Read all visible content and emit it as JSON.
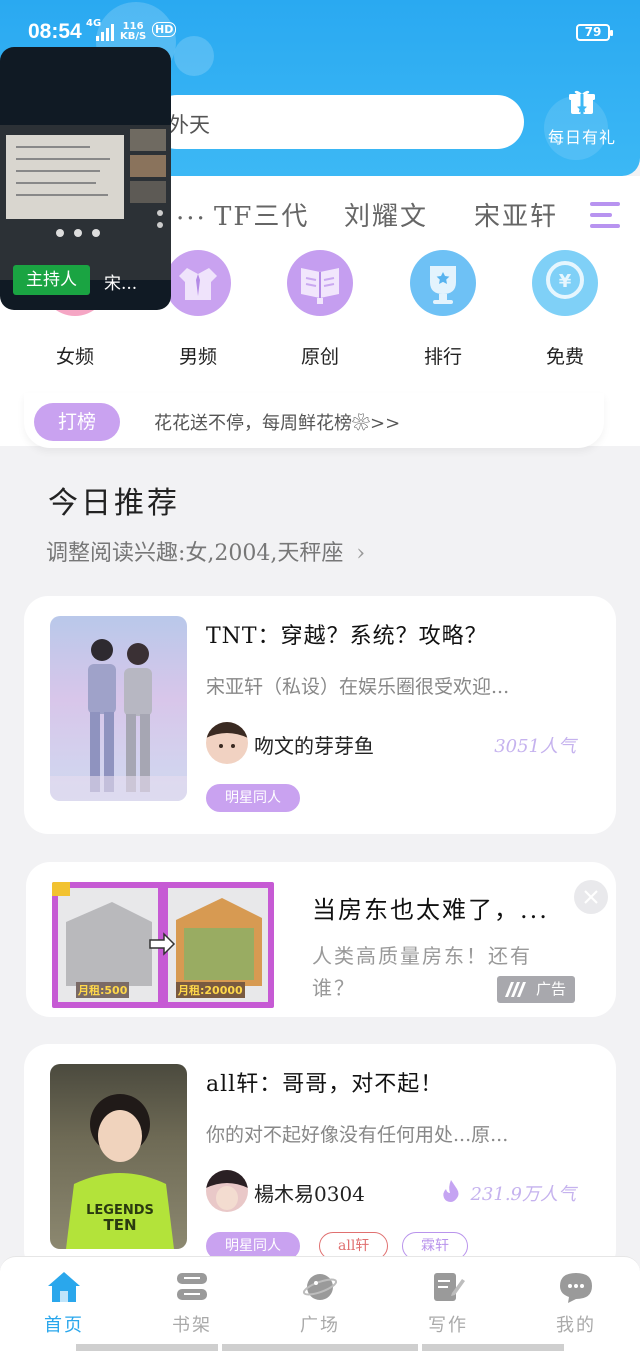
{
  "status_bar": {
    "time": "08:54",
    "network": "4G",
    "speed_value": "116",
    "speed_unit": "KB/S",
    "hd": "HD",
    "battery": "79"
  },
  "header": {
    "search_text": "外天",
    "daily_gift_label": "每日有礼",
    "gift_icon": "gift-icon"
  },
  "category_tabs": [
    "TF三代",
    "刘耀文",
    "宋亚轩"
  ],
  "nav_items": [
    {
      "label": "女频",
      "icon": "female-icon",
      "color": "#f5a6c4"
    },
    {
      "label": "男频",
      "icon": "shirt-icon",
      "color": "#c9a2f0"
    },
    {
      "label": "原创",
      "icon": "book-icon",
      "color": "#c59ef0"
    },
    {
      "label": "排行",
      "icon": "trophy-icon",
      "color": "#6ec1f5"
    },
    {
      "label": "免费",
      "icon": "coin-icon",
      "color": "#7fd0f7"
    }
  ],
  "rank_bar": {
    "badge": "打榜",
    "text": "花花送不停，每周鲜花榜❀>>"
  },
  "section": {
    "title": "今日推荐",
    "subtitle": "调整阅读兴趣:女,2004,天秤座"
  },
  "books": [
    {
      "title": "TNT：穿越？系统？攻略？",
      "desc": "宋亚轩（私设）在娱乐圈很受欢迎...",
      "author": "吻文的芽芽鱼",
      "popularity": "3051人气",
      "tags": [
        "明星同人"
      ]
    },
    {
      "title": "all轩：哥哥，对不起！",
      "desc": "你的对不起好像没有任何用处...原...",
      "author": "楊木易0304",
      "popularity": "231.9万人气",
      "tags": [
        "明星同人",
        "all轩",
        "霖轩"
      ]
    }
  ],
  "ad": {
    "title": "当房东也太难了，...",
    "desc": "人类高质量房东！还有谁？",
    "badge": "广告",
    "image_label_left": "月租:500",
    "image_label_right": "月租:20000"
  },
  "video_overlay": {
    "host_badge": "主持人",
    "host_name": "宋..."
  },
  "bottom_nav": [
    "首页",
    "书架",
    "广场",
    "写作",
    "我的"
  ],
  "colors": {
    "brand_blue": "#2aa9f1",
    "accent_purple": "#c9a2f0",
    "active_tab": "#2aa7ec"
  }
}
